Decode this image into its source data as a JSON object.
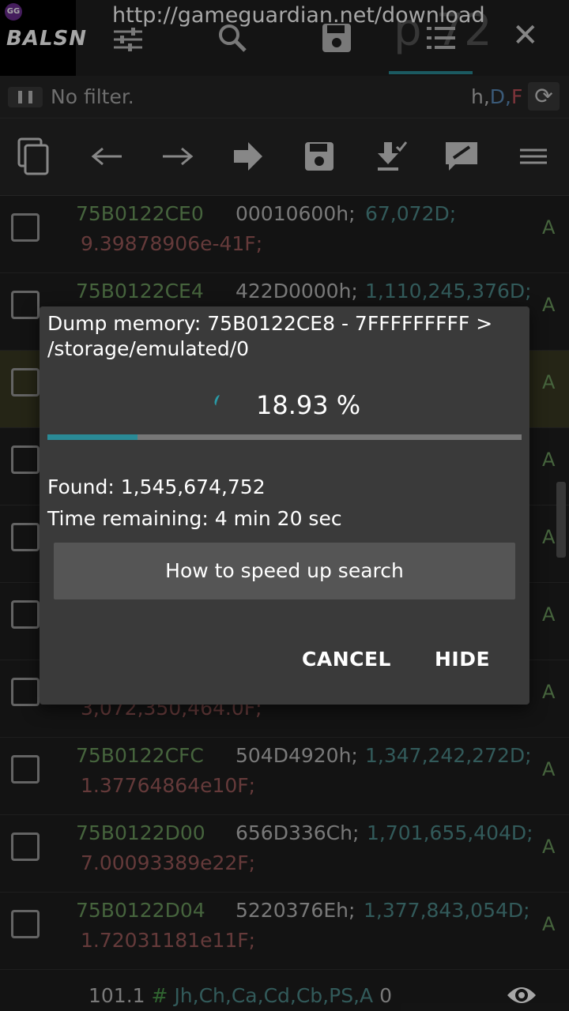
{
  "app": {
    "logo_badge": "GG",
    "logo_text": "BALSN",
    "url": "http://gameguardian.net/download",
    "accent_color": "#2a8a96"
  },
  "filter": {
    "text": "No filter.",
    "types_h": "h,",
    "types_d": "D,",
    "types_f": "F"
  },
  "toolbar": {
    "icons": [
      "copy-icon",
      "back-icon",
      "forward-icon",
      "go-icon",
      "save-icon",
      "download-icon",
      "edit-icon",
      "menu-icon"
    ]
  },
  "rows": [
    {
      "address": "75B0122CE0",
      "hex": "00010600h;",
      "dword": "67,072D;",
      "float": "9.39878906e-41F;",
      "flag": "A"
    },
    {
      "address": "75B0122CE4",
      "hex": "422D0000h;",
      "dword": "1,110,245,376D;",
      "float": "",
      "flag": "A"
    },
    {
      "address": "",
      "hex": "",
      "dword": "",
      "float": "",
      "flag": "A"
    },
    {
      "address": "",
      "hex": "",
      "dword": "",
      "float": "",
      "flag": "A"
    },
    {
      "address": "",
      "hex": "",
      "dword": "",
      "float": "",
      "flag": "A"
    },
    {
      "address": "",
      "hex": "",
      "dword": "",
      "float": "",
      "flag": "A"
    },
    {
      "address": "",
      "hex": "",
      "dword": "",
      "float": "3,072,350,464.0F;",
      "flag": "A"
    },
    {
      "address": "75B0122CFC",
      "hex": "504D4920h;",
      "dword": "1,347,242,272D;",
      "float": "1.37764864e10F;",
      "flag": "A"
    },
    {
      "address": "75B0122D00",
      "hex": "656D336Ch;",
      "dword": "1,701,655,404D;",
      "float": "7.00093389e22F;",
      "flag": "A"
    },
    {
      "address": "75B0122D04",
      "hex": "5220376Eh;",
      "dword": "1,377,843,054D;",
      "float": "1.72031181e11F;",
      "flag": "A"
    }
  ],
  "status": {
    "prefix": "101.1",
    "hash": "#",
    "types": "Jh,Ch,Ca,Cd,Cb,PS,A",
    "count": "0"
  },
  "dialog": {
    "title": "Dump memory: 75B0122CE8 - 7FFFFFFFFF > /storage/emulated/0",
    "percent": "18.93 %",
    "progress": 0.1893,
    "found": "Found: 1,545,674,752",
    "remaining": "Time remaining: 4 min 20 sec",
    "speed_button": "How to speed up search",
    "cancel": "CANCEL",
    "hide": "HIDE"
  }
}
